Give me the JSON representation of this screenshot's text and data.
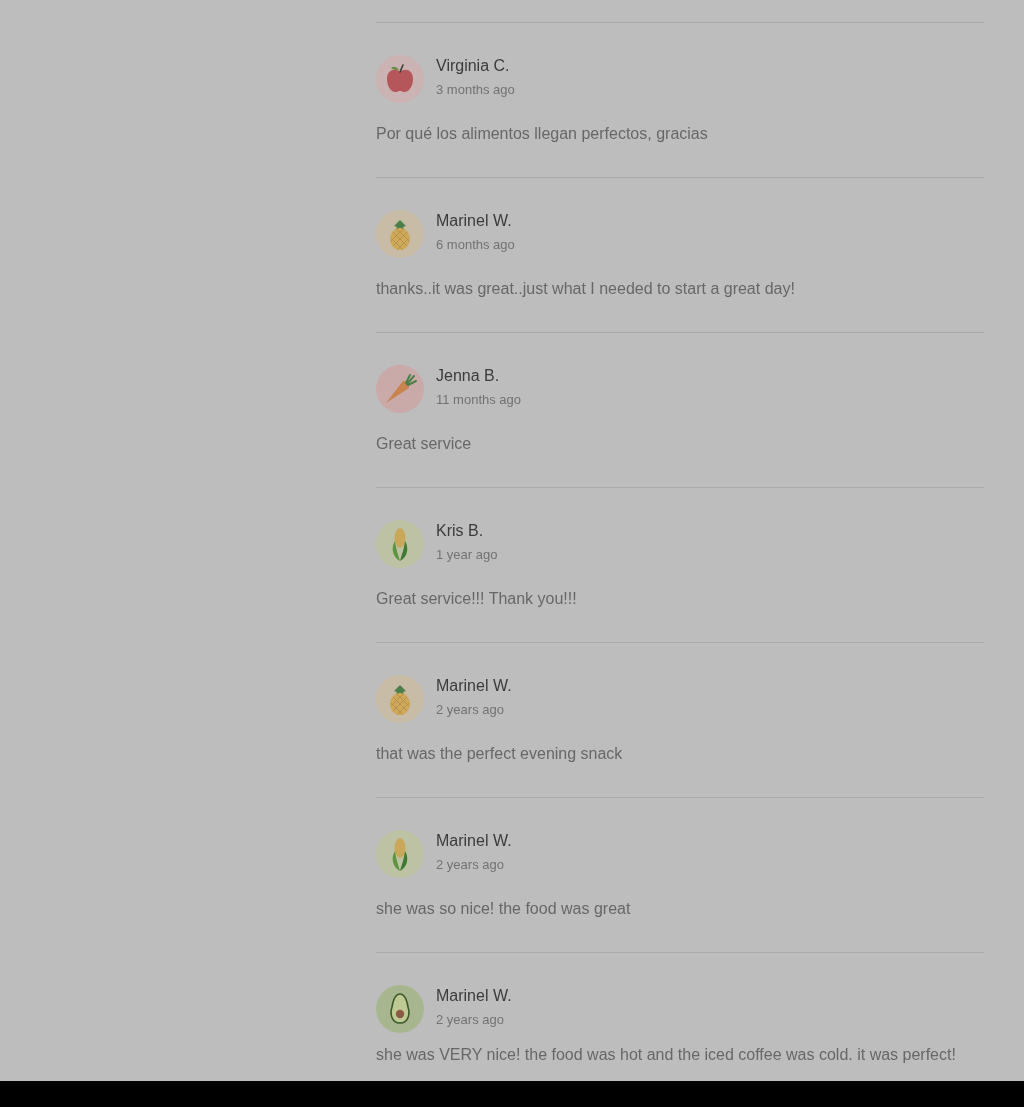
{
  "reviews": [
    {
      "avatar": {
        "kind": "apple"
      },
      "name": "Virginia C.",
      "time": "3 months ago",
      "text": "Por qué los alimentos llegan perfectos, gracias"
    },
    {
      "avatar": {
        "kind": "pineapple"
      },
      "name": "Marinel W.",
      "time": "6 months ago",
      "text": "thanks..it was great..just what I needed to start a great day!"
    },
    {
      "avatar": {
        "kind": "carrot"
      },
      "name": "Jenna B.",
      "time": "11 months ago",
      "text": "Great service"
    },
    {
      "avatar": {
        "kind": "corn"
      },
      "name": "Kris B.",
      "time": "1 year ago",
      "text": "Great service!!! Thank you!!!"
    },
    {
      "avatar": {
        "kind": "pineapple"
      },
      "name": "Marinel W.",
      "time": "2 years ago",
      "text": "that was the perfect evening snack"
    },
    {
      "avatar": {
        "kind": "corn"
      },
      "name": "Marinel W.",
      "time": "2 years ago",
      "text": "she was so nice! the food was great"
    },
    {
      "avatar": {
        "kind": "avocado"
      },
      "name": "Marinel W.",
      "time": "2 years ago",
      "text": "she was VERY nice! the food was hot and the iced coffee was cold. it was perfect!"
    }
  ]
}
